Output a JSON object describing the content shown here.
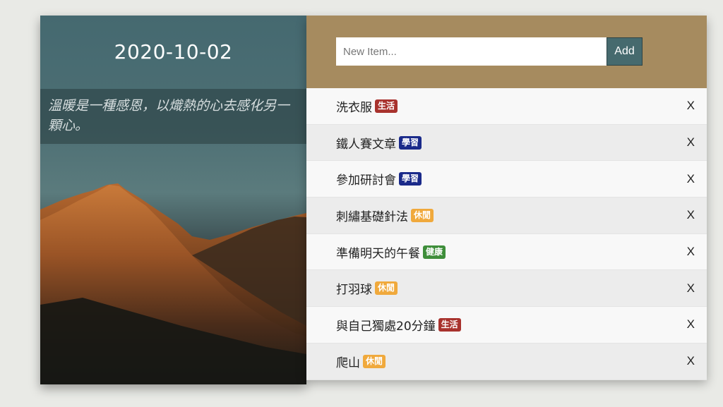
{
  "date": "2020-10-02",
  "quote": "溫暖是一種感恩，以熾熱的心去感化另一顆心。",
  "input": {
    "placeholder": "New Item...",
    "value": ""
  },
  "add_label": "Add",
  "delete_label": "X",
  "colors": {
    "header": "#a68b5f",
    "add_button": "#466a6e",
    "tag_生活": "#a8322d",
    "tag_學習": "#1a2a8a",
    "tag_休閒": "#f0a93c",
    "tag_健康": "#3e8e3a"
  },
  "items": [
    {
      "text": "洗衣服",
      "tag": "生活",
      "tag_color": "#a8322d"
    },
    {
      "text": "鐵人賽文章",
      "tag": "學習",
      "tag_color": "#1a2a8a"
    },
    {
      "text": "參加研討會",
      "tag": "學習",
      "tag_color": "#1a2a8a"
    },
    {
      "text": "刺繡基礎針法",
      "tag": "休閒",
      "tag_color": "#f0a93c"
    },
    {
      "text": "準備明天的午餐",
      "tag": "健康",
      "tag_color": "#3e8e3a"
    },
    {
      "text": "打羽球",
      "tag": "休閒",
      "tag_color": "#f0a93c"
    },
    {
      "text": "與自己獨處20分鐘",
      "tag": "生活",
      "tag_color": "#a8322d"
    },
    {
      "text": "爬山",
      "tag": "休閒",
      "tag_color": "#f0a93c"
    }
  ]
}
